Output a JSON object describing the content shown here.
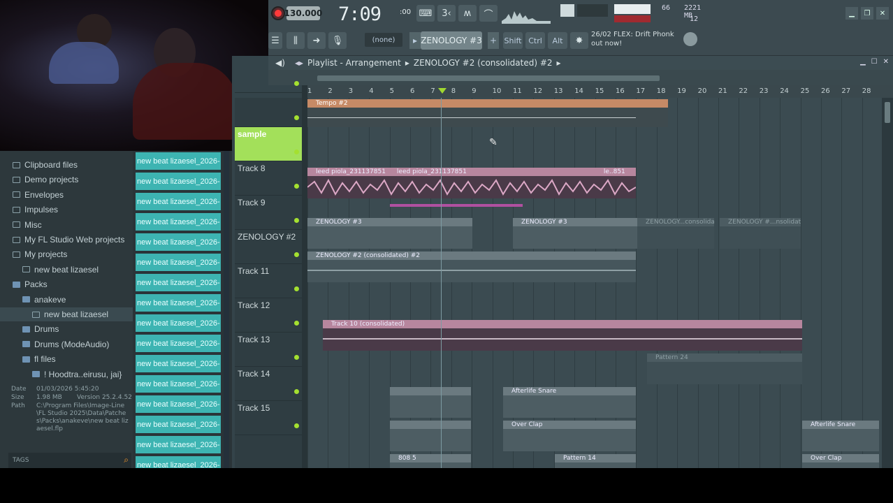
{
  "toolbar": {
    "tempo": "130.000",
    "time": "7:09",
    "time_ms": ":00",
    "pattern_mode": "(none)",
    "pattern_name": "ZENOLOGY #3",
    "modifiers": [
      "Shift",
      "Ctrl",
      "Alt"
    ],
    "cpu_value": "66",
    "ram": "2221 MB",
    "polyphony": "12",
    "hint_line1": "26/02  FLEX: Drift Phonk",
    "hint_line2": "out now!"
  },
  "playlist": {
    "section": "Playlist - Arrangement",
    "title": "ZENOLOGY #2 (consolidated) #2",
    "ruler": [
      "1",
      "2",
      "3",
      "4",
      "5",
      "6",
      "7",
      "8",
      "9",
      "10",
      "11",
      "12",
      "13",
      "14",
      "15",
      "16",
      "17",
      "18",
      "19",
      "20",
      "21",
      "22",
      "23",
      "24",
      "25",
      "26",
      "27",
      "28"
    ],
    "tracks": [
      {
        "name": ""
      },
      {
        "name": ""
      },
      {
        "name": "sample"
      },
      {
        "name": "Track 8"
      },
      {
        "name": "Track 9"
      },
      {
        "name": "ZENOLOGY #2"
      },
      {
        "name": "Track 11"
      },
      {
        "name": "Track 12"
      },
      {
        "name": "Track 13"
      },
      {
        "name": "Track 14"
      },
      {
        "name": "Track 15"
      }
    ],
    "clips": {
      "tempo": "Tempo #2",
      "sample_a": "leed piola_231137851",
      "sample_b": "leed piola_231137851",
      "sample_c": "le..851",
      "zen3_a": "ZENOLOGY #3",
      "zen3_b": "ZENOLOGY #3",
      "ghost_a": "ZENOLOGY...consolidated",
      "ghost_b": "ZENOLOGY #...nsolidated",
      "zen2": "ZENOLOGY #2 (consolidated) #2",
      "track10": "Track 10 (consolidated)",
      "pattern24": "Pattern 24",
      "afterlife": "Afterlife Snare",
      "overclap": "Over Clap",
      "afterlife2": "Afterlife Snare",
      "overclap2": "Over Clap",
      "b808": "808 5",
      "pattern14": "Pattern 14"
    }
  },
  "browser": {
    "items": [
      {
        "label": "Clipboard files",
        "indent": 0,
        "type": "folder"
      },
      {
        "label": "Demo projects",
        "indent": 0,
        "type": "folder"
      },
      {
        "label": "Envelopes",
        "indent": 0,
        "type": "folder"
      },
      {
        "label": "Impulses",
        "indent": 0,
        "type": "folder"
      },
      {
        "label": "Misc",
        "indent": 0,
        "type": "folder"
      },
      {
        "label": "My FL Studio Web projects",
        "indent": 0,
        "type": "folder"
      },
      {
        "label": "My projects",
        "indent": 0,
        "type": "folder-open"
      },
      {
        "label": "new beat lizaesel",
        "indent": 1,
        "type": "folder"
      },
      {
        "label": "Packs",
        "indent": 0,
        "type": "pack"
      },
      {
        "label": "anakeve",
        "indent": 1,
        "type": "pack"
      },
      {
        "label": "new beat lizaesel",
        "indent": 2,
        "type": "file"
      },
      {
        "label": "Drums",
        "indent": 1,
        "type": "pack"
      },
      {
        "label": "Drums (ModeAudio)",
        "indent": 1,
        "type": "pack"
      },
      {
        "label": "fl files",
        "indent": 1,
        "type": "pack"
      },
      {
        "label": "! Hoodtra..eirusu, jai}",
        "indent": 2,
        "type": "pack"
      }
    ],
    "info_date_label": "Date",
    "info_date": "01/03/2026 5:45:20",
    "info_size_label": "Size",
    "info_size": "1.98 MB",
    "info_version": "Version 25.2.4.52",
    "info_path_label": "Path",
    "info_path": "C:\\Program Files\\Image-Line\\FL Studio 2025\\Data\\Patches\\Packs\\anakeve\\new beat lizaesel.flp",
    "tags": "TAGS"
  },
  "project_list": {
    "items": [
      "new beat lizaesel_2026-",
      "new beat lizaesel_2026-",
      "new beat lizaesel_2026-",
      "new beat lizaesel_2026-",
      "new beat lizaesel_2026-",
      "new beat lizaesel_2026-",
      "new beat lizaesel_2026-",
      "new beat lizaesel_2026-",
      "new beat lizaesel_2026-",
      "new beat lizaesel_2026-",
      "new beat lizaesel_2026-",
      "new beat lizaesel_2026-",
      "new beat lizaesel_2026-",
      "new beat lizaesel_2026-",
      "new beat lizaesel_2026-",
      "new beat lizaesel_2026-"
    ]
  },
  "colors": {
    "accent_green": "#a4e030",
    "teal": "#3db4b2",
    "sample_track": "#a3e05a",
    "tempo_clip": "#c68a66",
    "pink_clip": "#b7869e"
  }
}
